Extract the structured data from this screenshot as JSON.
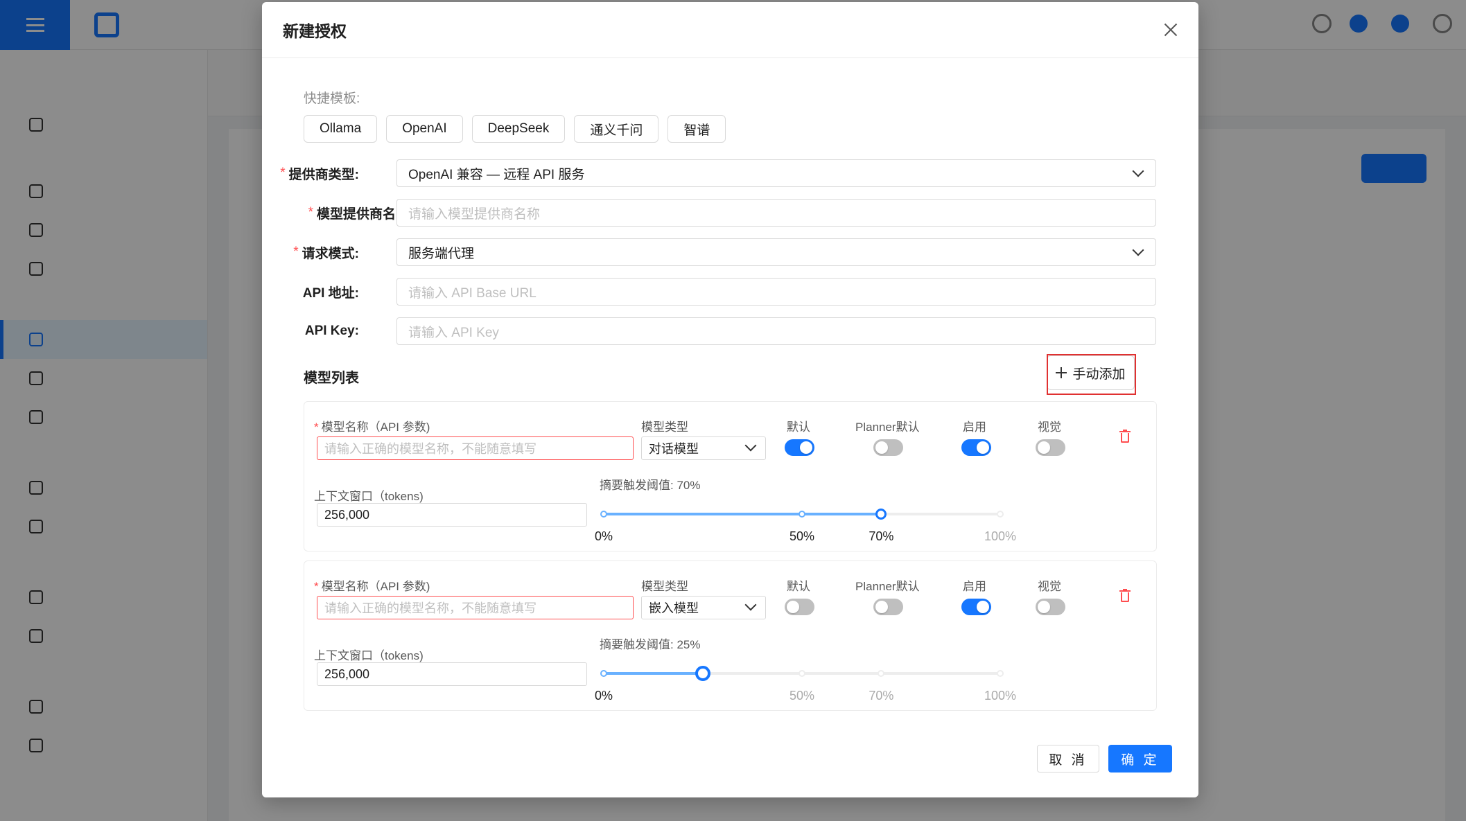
{
  "modal": {
    "title": "新建授权",
    "template_label": "快捷模板:",
    "templates": [
      "Ollama",
      "OpenAI",
      "DeepSeek",
      "通义千问",
      "智谱"
    ],
    "fields": {
      "provider_type": {
        "label": "提供商类型:",
        "value": "OpenAI 兼容 — 远程 API 服务"
      },
      "provider_name": {
        "label": "模型提供商名",
        "placeholder": "请输入模型提供商名称"
      },
      "request_mode": {
        "label": "请求模式:",
        "value": "服务端代理"
      },
      "api_url": {
        "label": "API 地址:",
        "placeholder": "请输入 API Base URL"
      },
      "api_key": {
        "label": "API Key:",
        "placeholder": "请输入 API Key"
      }
    },
    "model_list_title": "模型列表",
    "manual_add_label": "手动添加",
    "models": [
      {
        "name_label": "模型名称（API 参数)",
        "name_placeholder": "请输入正确的模型名称，不能随意填写",
        "type_label": "模型类型",
        "type_value": "对话模型",
        "toggles": [
          {
            "label": "默认",
            "on": true
          },
          {
            "label": "Planner默认",
            "on": false
          },
          {
            "label": "启用",
            "on": true
          },
          {
            "label": "视觉",
            "on": false
          }
        ],
        "ctx_label": "上下文窗口（tokens)",
        "ctx_value": "256,000",
        "threshold_label": "摘要触发阈值: 70%",
        "threshold": 70,
        "marks": [
          "0%",
          "50%",
          "70%",
          "100%"
        ]
      },
      {
        "name_label": "模型名称（API 参数)",
        "name_placeholder": "请输入正确的模型名称，不能随意填写",
        "type_label": "模型类型",
        "type_value": "嵌入模型",
        "toggles": [
          {
            "label": "默认",
            "on": false
          },
          {
            "label": "Planner默认",
            "on": false
          },
          {
            "label": "启用",
            "on": true
          },
          {
            "label": "视觉",
            "on": false
          }
        ],
        "ctx_label": "上下文窗口（tokens)",
        "ctx_value": "256,000",
        "threshold_label": "摘要触发阈值: 25%",
        "threshold": 25,
        "marks": [
          "0%",
          "50%",
          "70%",
          "100%"
        ]
      }
    ],
    "cancel_label": "取 消",
    "ok_label": "确 定"
  },
  "colors": {
    "primary": "#1677ff",
    "danger": "#ff4d4f",
    "highlight": "#e03131"
  }
}
